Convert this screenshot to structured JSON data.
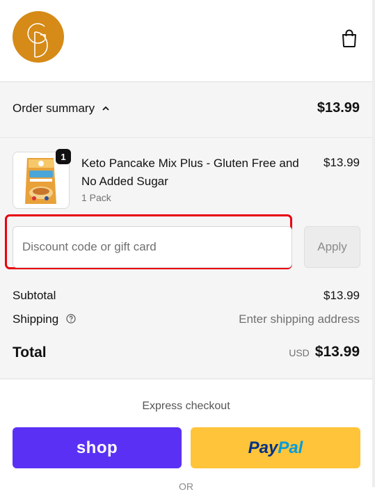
{
  "header": {
    "logo_text": "GD",
    "cart_icon": "shopping-bag-icon"
  },
  "summary": {
    "toggle_label": "Order summary",
    "toggle_icon": "chevron-up-icon",
    "total": "$13.99"
  },
  "line_item": {
    "quantity": "1",
    "name": "Keto Pancake Mix Plus - Gluten Free and No Added Sugar",
    "variant": "1 Pack",
    "price": "$13.99"
  },
  "discount": {
    "placeholder": "Discount code or gift card",
    "value": "",
    "apply_label": "Apply"
  },
  "totals": {
    "subtotal_label": "Subtotal",
    "subtotal_value": "$13.99",
    "shipping_label": "Shipping",
    "shipping_help_icon": "question-circle-icon",
    "shipping_value": "Enter shipping address",
    "total_label": "Total",
    "currency": "USD",
    "total_value": "$13.99"
  },
  "express": {
    "label": "Express checkout",
    "shop_label": "shop",
    "paypal_label_a": "Pay",
    "paypal_label_b": "Pal",
    "or_label": "OR"
  },
  "colors": {
    "logo": "#d68a17",
    "shop_pay": "#5a31f4",
    "paypal": "#ffc439",
    "highlight": "#e8000e"
  }
}
